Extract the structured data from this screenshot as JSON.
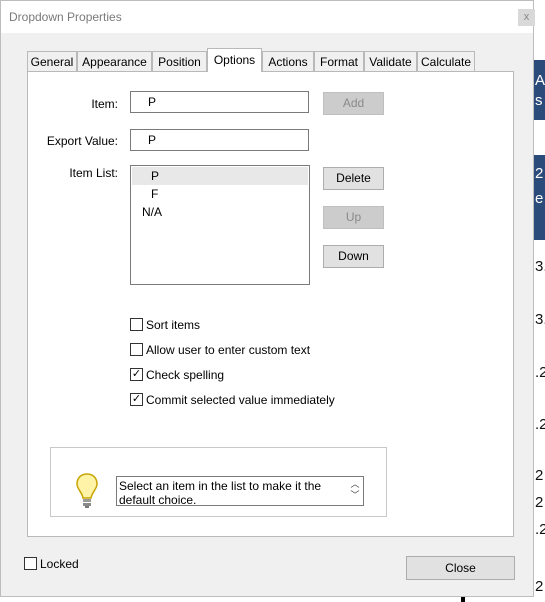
{
  "window": {
    "title": "Dropdown Properties",
    "close_glyph": "x"
  },
  "tabs": [
    {
      "label": "General"
    },
    {
      "label": "Appearance"
    },
    {
      "label": "Position"
    },
    {
      "label": "Options"
    },
    {
      "label": "Actions"
    },
    {
      "label": "Format"
    },
    {
      "label": "Validate"
    },
    {
      "label": "Calculate"
    }
  ],
  "active_tab": "Options",
  "options": {
    "item_label": "Item:",
    "item_value": "P",
    "add_label": "Add",
    "export_label": "Export Value:",
    "export_value": "P",
    "item_list_label": "Item List:",
    "items": [
      "P",
      "F",
      "N/A"
    ],
    "selected_item": "P",
    "delete_label": "Delete",
    "up_label": "Up",
    "down_label": "Down",
    "checkboxes": [
      {
        "label": "Sort items",
        "checked": false
      },
      {
        "label": "Allow user to enter custom text",
        "checked": false
      },
      {
        "label": "Check spelling",
        "checked": true
      },
      {
        "label": "Commit selected value immediately",
        "checked": true
      }
    ],
    "tip_text": "Select an item in the list to make it the default choice."
  },
  "footer": {
    "locked_label": "Locked",
    "locked_checked": false,
    "close_label": "Close"
  },
  "background_fragments": [
    "A",
    "s",
    "2",
    "e",
    "3.",
    "3.",
    ".2",
    ".2",
    "2",
    "2",
    ".2",
    "2"
  ]
}
